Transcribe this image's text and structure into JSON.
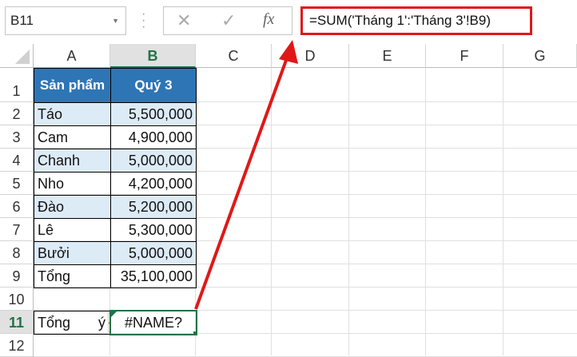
{
  "name_box": "B11",
  "formula_bar": {
    "cancel_icon": "✕",
    "enter_icon": "✓",
    "fx_label": "fx",
    "formula": "=SUM('Tháng 1':'Tháng 3'!B9)"
  },
  "columns": [
    "A",
    "B",
    "C",
    "D",
    "E",
    "F",
    "G"
  ],
  "rows": [
    "1",
    "2",
    "3",
    "4",
    "5",
    "6",
    "7",
    "8",
    "9",
    "10",
    "11",
    "12"
  ],
  "table": {
    "headers": [
      "Sản phẩm",
      "Quý 3"
    ],
    "data": [
      [
        "Táo",
        "5,500,000"
      ],
      [
        "Cam",
        "4,900,000"
      ],
      [
        "Chanh",
        "5,000,000"
      ],
      [
        "Nho",
        "4,200,000"
      ],
      [
        "Đào",
        "5,200,000"
      ],
      [
        "Lê",
        "5,300,000"
      ],
      [
        "Bưởi",
        "5,000,000"
      ],
      [
        "Tổng",
        "35,100,000"
      ]
    ]
  },
  "row11": {
    "a_left": "Tổng",
    "a_right": "ý",
    "warning_icon": "!",
    "b_value": "#NAME?"
  },
  "colors": {
    "header_blue": "#2e75b6",
    "alt_row": "#ddebf7",
    "highlight_red": "#e01818",
    "selection_green": "#217346"
  }
}
